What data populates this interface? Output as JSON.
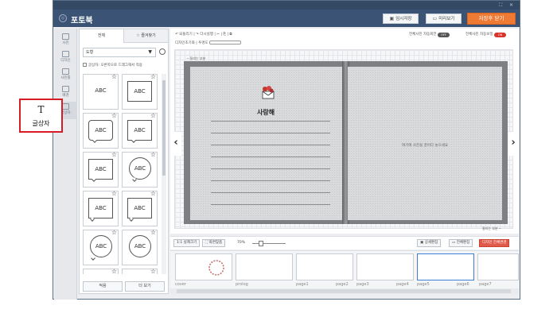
{
  "app": {
    "title": "포토북"
  },
  "toolbar": {
    "temp_save": "임시저장",
    "preview": "미리보기",
    "save_close": "저장후 닫기"
  },
  "leftnav": {
    "items": [
      {
        "label": "사진",
        "icon": "photo-icon"
      },
      {
        "label": "디자인",
        "icon": "design-icon"
      },
      {
        "label": "사진틀",
        "icon": "frame-icon"
      },
      {
        "label": "배경",
        "icon": "background-icon"
      },
      {
        "label": "글상자",
        "icon": "textbox-icon"
      }
    ]
  },
  "panel": {
    "tabs": [
      {
        "label": "전체"
      },
      {
        "label": "즐겨찾기"
      }
    ],
    "select_value": "도형",
    "hint": "글상자: 오른쪽으로 드래그해서 적용",
    "cells": [
      {
        "text": "ABC"
      },
      {
        "text": "ABC"
      },
      {
        "text": "ABC"
      },
      {
        "text": "ABC"
      },
      {
        "text": "ABC"
      },
      {
        "text": "ABC"
      },
      {
        "text": "ABC"
      },
      {
        "text": "ABC"
      },
      {
        "text": "ABC"
      },
      {
        "text": "ABC"
      }
    ],
    "apply_button": "적용",
    "more_button": "더 보기"
  },
  "canvas": {
    "tool1": "↶ 되돌리기  |  ↷ 다시실행  |  ✂  |  ⎘  |  ⧉",
    "tool2": "디자인초기화  |  투명도",
    "auto_layout_label": "전체사진 자동회전",
    "auto_layout_state": "OFF",
    "auto_correct_label": "전체사진 자동보정",
    "auto_correct_state": "ON",
    "cut_label_top": "─ 잘리는 부분",
    "cut_label_bottom": "잘리는 부분 ─",
    "left_page_logo": "사랑해",
    "right_page_text": "여기에 사진을 끌어다 놓으세요",
    "prev_arrow": "‹",
    "next_arrow": "›"
  },
  "bottombar": {
    "fit": "1:1 실제크기",
    "fullscreen": "화면맞춤",
    "zoom": "70%",
    "detail_edit": "상세편집",
    "full_edit": "전체편집",
    "design_change": "디자인 전체변경"
  },
  "thumbs": [
    {
      "label": "cover"
    },
    {
      "label": "prolog"
    },
    {
      "label": "page1"
    },
    {
      "label": "page2"
    },
    {
      "label": "page3"
    },
    {
      "label": "page4"
    },
    {
      "label": "page5"
    },
    {
      "label": "page6"
    },
    {
      "label": "page7"
    }
  ],
  "tooltip": {
    "icon": "T",
    "label": "글상자"
  }
}
